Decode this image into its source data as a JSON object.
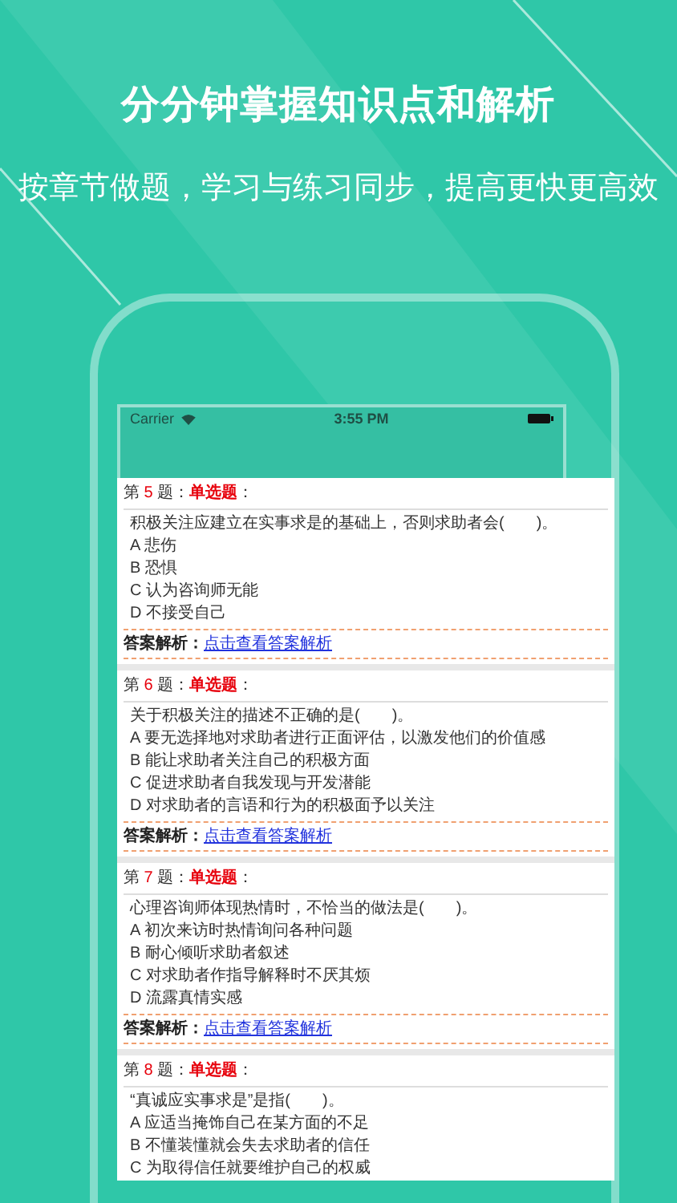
{
  "headline": "分分钟掌握知识点和解析",
  "subtitle": "按章节做题，学习与练习同步，提高更快更高效",
  "status_bar": {
    "carrier": "Carrier",
    "time": "3:55 PM"
  },
  "questions": [
    {
      "prefix": "第",
      "number": "5",
      "suffix": "题：",
      "type": "单选题",
      "type_suffix": "：",
      "stem": "积极关注应建立在实事求是的基础上，否则求助者会(　　)。",
      "options": [
        "A 悲伤",
        "B 恐惧",
        "C 认为咨询师无能",
        "D 不接受自己"
      ],
      "answer_label": "答案解析：",
      "answer_link": "点击查看答案解析"
    },
    {
      "prefix": "第",
      "number": "6",
      "suffix": "题：",
      "type": "单选题",
      "type_suffix": "：",
      "stem": "关于积极关注的描述不正确的是(　　)。",
      "options": [
        "A 要无选择地对求助者进行正面评估，以激发他们的价值感",
        "B 能让求助者关注自己的积极方面",
        "C 促进求助者自我发现与开发潜能",
        "D 对求助者的言语和行为的积极面予以关注"
      ],
      "answer_label": "答案解析：",
      "answer_link": "点击查看答案解析"
    },
    {
      "prefix": "第",
      "number": "7",
      "suffix": "题：",
      "type": "单选题",
      "type_suffix": "：",
      "stem": "心理咨询师体现热情时，不恰当的做法是(　　)。",
      "options": [
        "A 初次来访时热情询问各种问题",
        "B 耐心倾听求助者叙述",
        "C 对求助者作指导解释时不厌其烦",
        "D 流露真情实感"
      ],
      "answer_label": "答案解析：",
      "answer_link": "点击查看答案解析"
    },
    {
      "prefix": "第",
      "number": "8",
      "suffix": "题：",
      "type": "单选题",
      "type_suffix": "：",
      "stem": "“真诚应实事求是”是指(　　)。",
      "options": [
        "A 应适当掩饰自己在某方面的不足",
        "B 不懂装懂就会失去求助者的信任",
        "C 为取得信任就要维护自己的权威"
      ]
    }
  ]
}
